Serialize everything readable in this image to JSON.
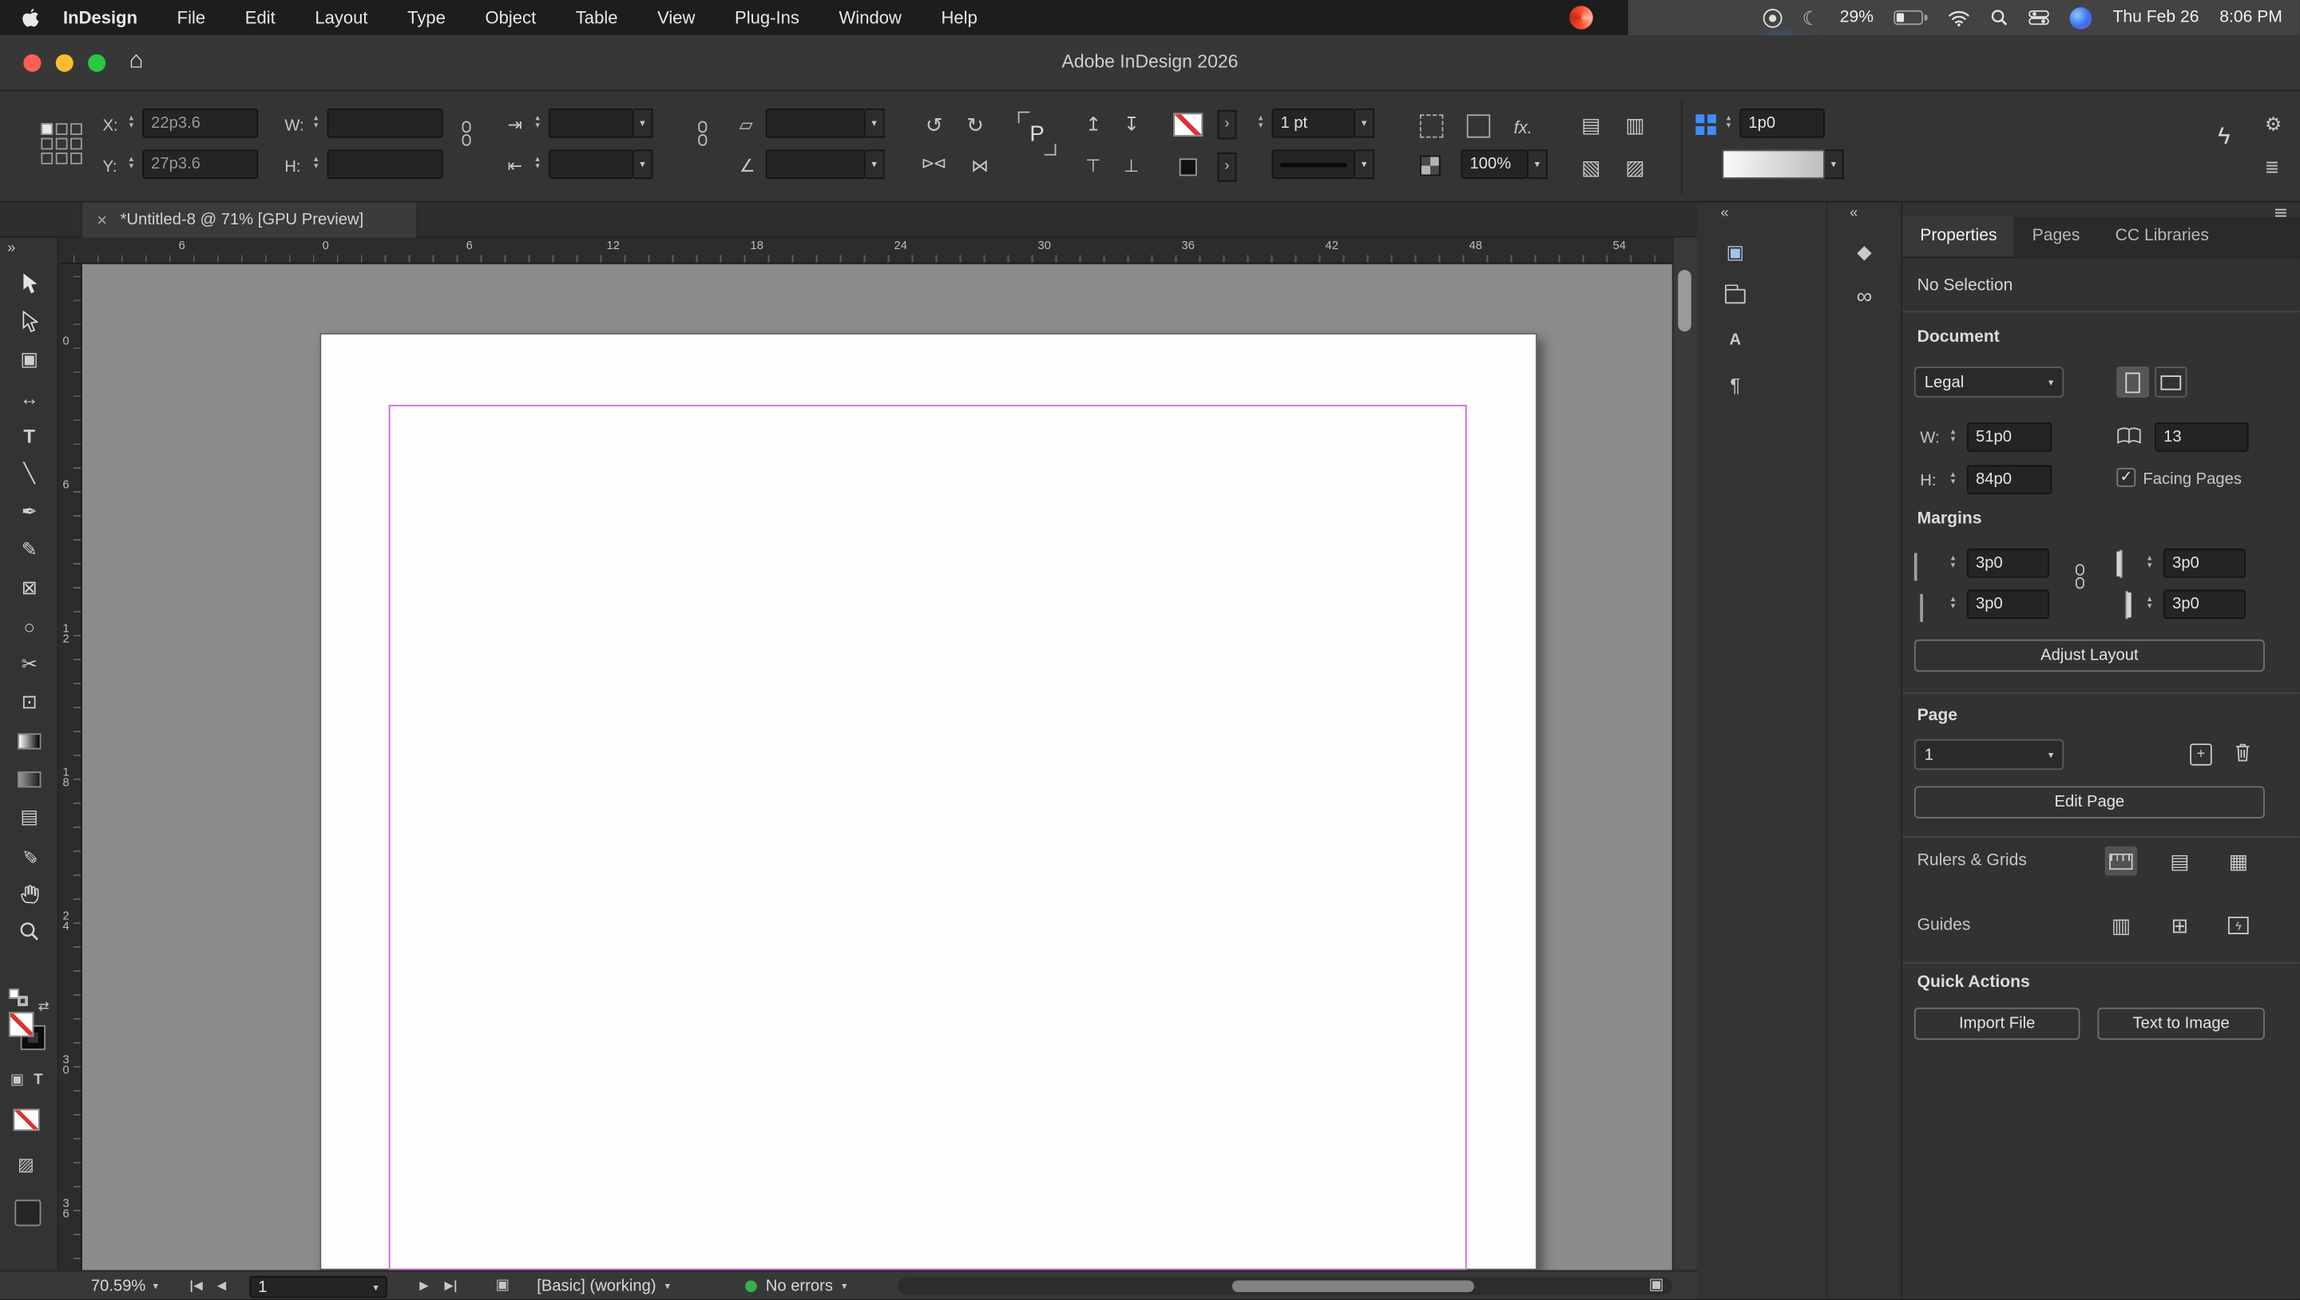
{
  "colors": {
    "accent_blue": "#3f8cff",
    "success_green": "#35b24a",
    "margin_guide": "#cf6fcf",
    "traffic_red": "#ff5f57",
    "traffic_yellow": "#febc2e",
    "traffic_green": "#28c840"
  },
  "menubar": {
    "app_name": "InDesign",
    "items": [
      "File",
      "Edit",
      "Layout",
      "Type",
      "Object",
      "Table",
      "View",
      "Plug-Ins",
      "Window",
      "Help"
    ],
    "battery_percent": "29%",
    "date": "Thu Feb 26",
    "time": "8:06 PM"
  },
  "titlebar": {
    "title": "Adobe InDesign 2026"
  },
  "control_panel": {
    "x_label": "X:",
    "x_value": "22p3.6",
    "y_label": "Y:",
    "y_value": "27p3.6",
    "w_label": "W:",
    "w_value": "",
    "h_label": "H:",
    "h_value": "",
    "stroke_weight": "1 pt",
    "opacity": "100%",
    "effects_label": "fx.",
    "spacing_value": "1p0",
    "p_badge": "P"
  },
  "document_tab": {
    "title": "*Untitled-8 @ 71% [GPU Preview]"
  },
  "rulers": {
    "horizontal": [
      "6",
      "0",
      "6",
      "12",
      "18",
      "24",
      "30",
      "36",
      "42",
      "48",
      "54"
    ],
    "vertical": [
      "0",
      "6",
      "12",
      "18",
      "24",
      "30",
      "36"
    ]
  },
  "tool_glyphs": {
    "page": "▣",
    "gap": "↔",
    "type": "T",
    "line": "╲",
    "pen": "✒",
    "pencil": "✎",
    "rectangle_frame": "⊠",
    "ellipse": "○",
    "scissors": "✂",
    "free_transform": "⊡",
    "note": "▤",
    "eyedropper": "✎"
  },
  "icons": {
    "collapse_left": "«",
    "collapse_right": "»",
    "close": "×",
    "home": "⌂",
    "moon": "☾",
    "lightning": "ϟ",
    "gear": "⚙",
    "panel_menu": "≣",
    "rotate_ccw": "↺",
    "rotate_cw": "↻",
    "flip_pair": "⊳⊲",
    "bowtie": "⋈",
    "arrow_bar_right": "⇥",
    "arrow_bar_left": "⇤",
    "shear": "▱",
    "angle": "∠",
    "arrow_up_bar": "↥",
    "arrow_down_bar": "↧",
    "tack_up": "⊤",
    "tack_down": "⊥",
    "chevron_right": "›",
    "swap_arrows": "⇄",
    "wrap_a": "▤",
    "wrap_b": "▥",
    "wrap_c": "▧",
    "wrap_d": "▨",
    "doc": "▣",
    "paragraph": "¶",
    "char_style": "A",
    "link_chain": "∞",
    "layers": "◆",
    "check": "✓",
    "plus": "+",
    "tri_left": "◀",
    "tri_right": "▶",
    "grid_lines": "▤",
    "grid_full": "▦",
    "grid_cols": "▥",
    "grid_plus": "⊞",
    "type_letter": "T",
    "screen_grid": "▨"
  },
  "properties_panel": {
    "tabs": [
      "Properties",
      "Pages",
      "CC Libraries"
    ],
    "no_selection": "No Selection",
    "document_heading": "Document",
    "preset": "Legal",
    "w_label": "W:",
    "w_value": "51p0",
    "h_label": "H:",
    "h_value": "84p0",
    "pages_value": "13",
    "facing_pages_label": "Facing Pages",
    "margins_heading": "Margins",
    "margin_top": "3p0",
    "margin_bottom": "3p0",
    "margin_left": "3p0",
    "margin_right": "3p0",
    "adjust_layout_label": "Adjust Layout",
    "page_heading": "Page",
    "page_value": "1",
    "edit_page_label": "Edit Page",
    "rulers_grids_label": "Rulers & Grids",
    "guides_label": "Guides",
    "quick_actions_heading": "Quick Actions",
    "import_file_label": "Import File",
    "text_to_image_label": "Text to Image"
  },
  "status_bar": {
    "zoom": "70.59%",
    "page_value": "1",
    "preflight_profile": "[Basic] (working)",
    "errors": "No errors"
  }
}
